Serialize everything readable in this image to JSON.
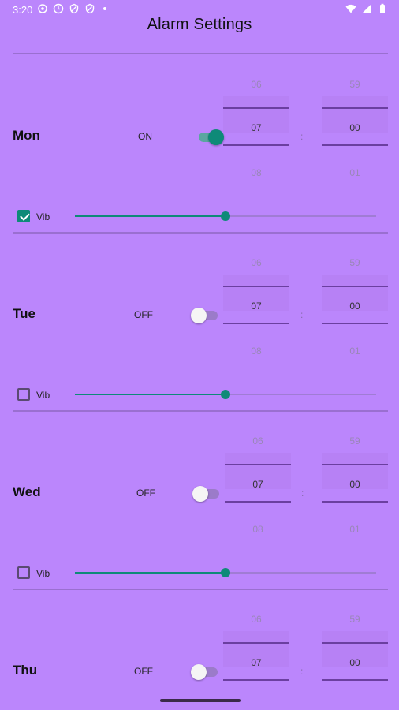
{
  "status_bar": {
    "time": "3:20",
    "left_icons": [
      "settings-notification-icon",
      "clock-notification-icon",
      "shield-notification-icon",
      "shield-notification-icon"
    ],
    "right_icons": [
      "wifi-icon",
      "cellular-icon",
      "battery-icon"
    ]
  },
  "app": {
    "title": "Alarm Settings"
  },
  "alarms": [
    {
      "day": "Mon",
      "state": "ON",
      "enabled": true,
      "hour": {
        "prev": "06",
        "current": "07",
        "next": "08"
      },
      "minute": {
        "prev": "59",
        "current": "00",
        "next": "01"
      },
      "separator": ":",
      "vibrate": {
        "label": "Vib",
        "checked": true
      },
      "volume": 0.5
    },
    {
      "day": "Tue",
      "state": "OFF",
      "enabled": false,
      "hour": {
        "prev": "06",
        "current": "07",
        "next": "08"
      },
      "minute": {
        "prev": "59",
        "current": "00",
        "next": "01"
      },
      "separator": ":",
      "vibrate": {
        "label": "Vib",
        "checked": false
      },
      "volume": 0.5
    },
    {
      "day": "Wed",
      "state": "OFF",
      "enabled": false,
      "hour": {
        "prev": "06",
        "current": "07",
        "next": "08"
      },
      "minute": {
        "prev": "59",
        "current": "00",
        "next": "01"
      },
      "separator": ":",
      "vibrate": {
        "label": "Vib",
        "checked": false
      },
      "volume": 0.5
    },
    {
      "day": "Thu",
      "state": "OFF",
      "enabled": false,
      "hour": {
        "prev": "06",
        "current": "07"
      },
      "minute": {
        "prev": "59",
        "current": "00"
      },
      "separator": ":"
    }
  ],
  "colors": {
    "background": "#BB86FC",
    "accent": "#0E8A78"
  }
}
